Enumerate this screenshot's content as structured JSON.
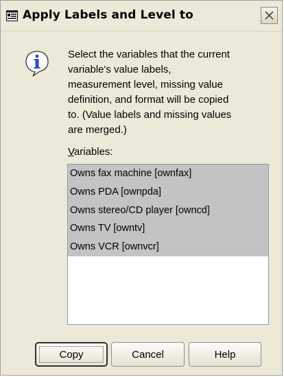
{
  "dialog": {
    "title": "Apply Labels and Level to",
    "close_icon": "close-icon",
    "app_icon": "dialog-app-icon"
  },
  "info": {
    "icon": "info-icon",
    "message": "Select the variables that the current\nvariable's value labels,\nmeasurement level, missing value\ndefinition, and format will be copied\nto. (Value labels and missing values\nare merged.)"
  },
  "variables": {
    "label_mnemonic": "V",
    "label_rest": "ariables:",
    "items": [
      "Owns fax machine [ownfax]",
      "Owns PDA [ownpda]",
      "Owns stereo/CD player [owncd]",
      "Owns TV [owntv]",
      "Owns VCR [ownvcr]"
    ]
  },
  "buttons": {
    "copy": "Copy",
    "cancel": "Cancel",
    "help": "Help"
  },
  "colors": {
    "dialog_bg": "#ece9d8",
    "selection_bg": "#c3c3c3",
    "list_border": "#7f9db9"
  }
}
